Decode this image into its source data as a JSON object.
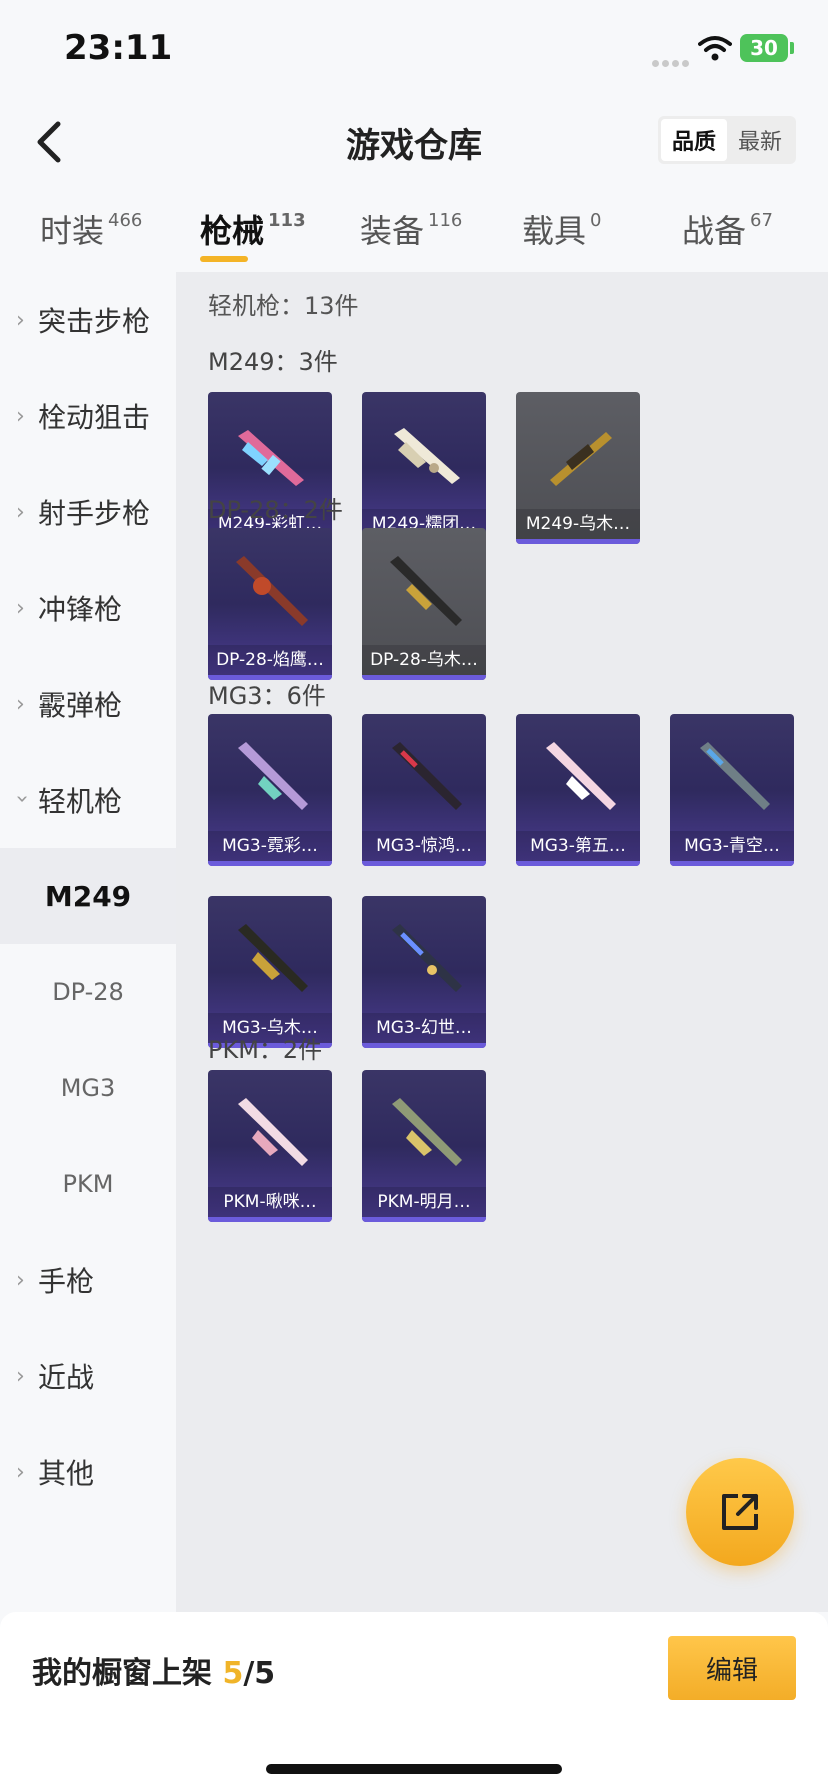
{
  "status": {
    "time": "23:11",
    "battery": "30"
  },
  "header": {
    "title": "游戏仓库",
    "sort": [
      "品质",
      "最新"
    ]
  },
  "tabs": [
    {
      "label": "时装",
      "count": "466"
    },
    {
      "label": "枪械",
      "count": "113"
    },
    {
      "label": "装备",
      "count": "116"
    },
    {
      "label": "载具",
      "count": "0"
    },
    {
      "label": "战备",
      "count": "67"
    }
  ],
  "sidebar": {
    "categories": [
      "突击步枪",
      "栓动狙击",
      "射手步枪",
      "冲锋枪",
      "霰弹枪",
      "轻机枪"
    ],
    "subs": [
      "M249",
      "DP-28",
      "MG3",
      "PKM"
    ],
    "more": [
      "手枪",
      "近战",
      "其他"
    ]
  },
  "content": {
    "section_title": "轻机枪：13件",
    "groups": [
      {
        "title": "M249：3件",
        "items": [
          "M249-彩虹…",
          "M249-糯团…",
          "M249-乌木…"
        ]
      },
      {
        "title": "DP-28：2件",
        "items": [
          "DP-28-焰鹰…",
          "DP-28-乌木…"
        ]
      },
      {
        "title": "MG3：6件",
        "items": [
          "MG3-霓彩…",
          "MG3-惊鸿…",
          "MG3-第五…",
          "MG3-青空…",
          "MG3-乌木…",
          "MG3-幻世…"
        ]
      },
      {
        "title": "PKM：2件",
        "items": [
          "PKM-啾咪…",
          "PKM-明月…"
        ]
      }
    ]
  },
  "bottom": {
    "label": "我的橱窗上架",
    "current": "5",
    "sep_total": "/5",
    "edit": "编辑"
  },
  "colors": {
    "accent": "#f4b427",
    "card_purple": "#3a3566",
    "card_gray": "#55565b"
  },
  "icons": [
    "back-arrow-icon",
    "wifi-icon",
    "battery-icon",
    "chevron-right-icon",
    "chevron-down-icon",
    "share-icon",
    "gun-icon"
  ]
}
